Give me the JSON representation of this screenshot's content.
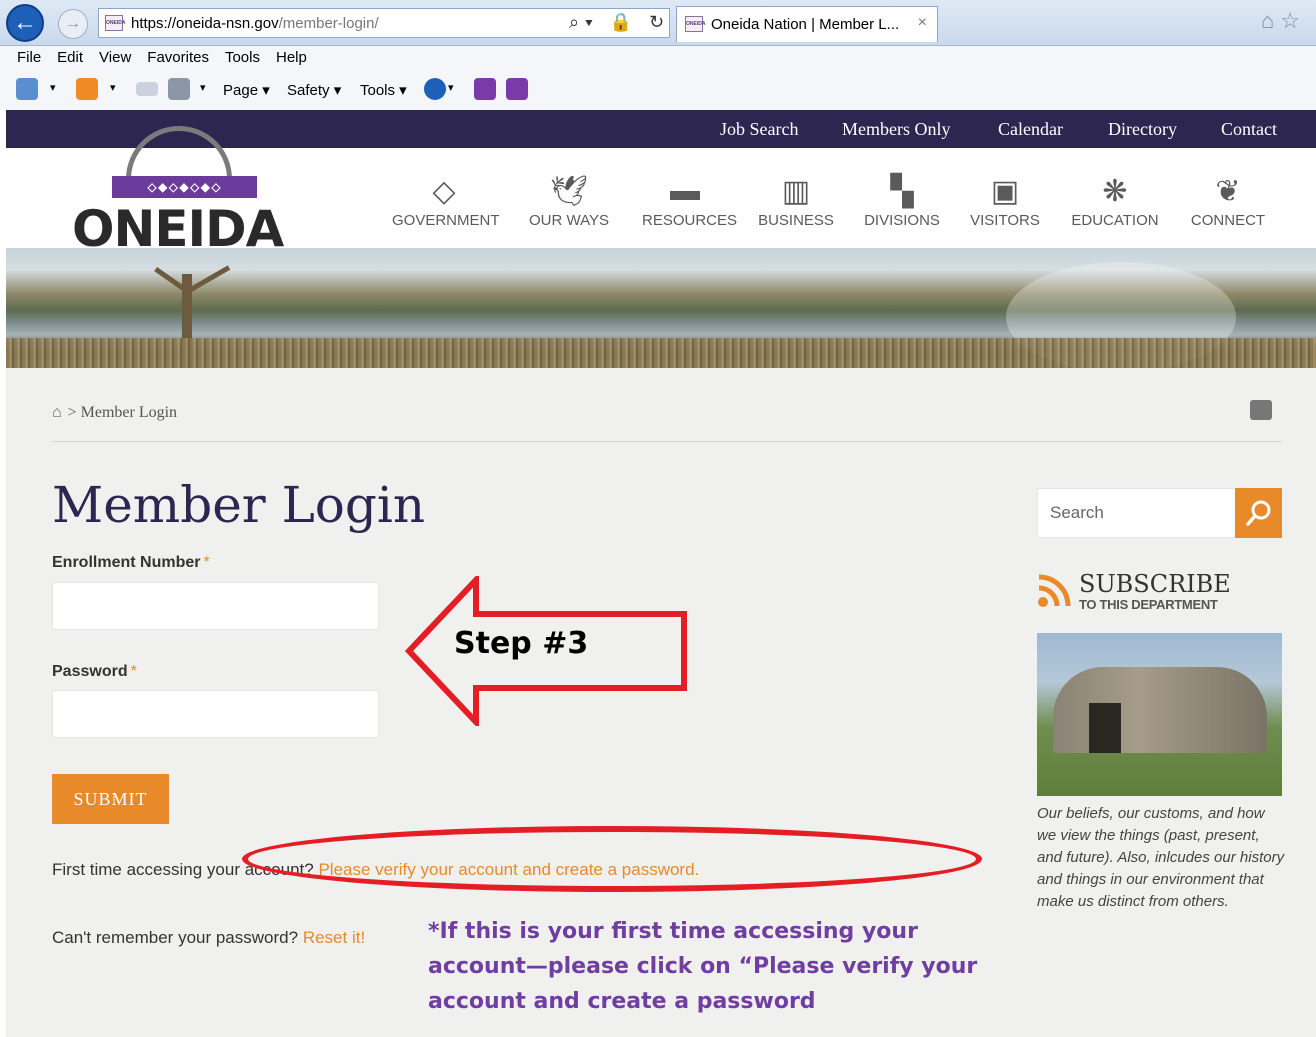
{
  "browser": {
    "url_host": "https://oneida-nsn.gov",
    "url_path": "/member-login/",
    "tab_title": "Oneida Nation | Member L...",
    "tab_close": "×",
    "menu": [
      "File",
      "Edit",
      "View",
      "Favorites",
      "Tools",
      "Help"
    ],
    "commands": {
      "page": "Page ▾",
      "safety": "Safety ▾",
      "tools": "Tools ▾"
    }
  },
  "site": {
    "top_links": [
      "Job Search",
      "Members Only",
      "Calendar",
      "Directory",
      "Contact"
    ],
    "logo_text": "ONEIDA",
    "nav": [
      "GOVERNMENT",
      "OUR WAYS",
      "RESOURCES",
      "BUSINESS",
      "DIVISIONS",
      "VISITORS",
      "EDUCATION",
      "CONNECT"
    ],
    "breadcrumb": "> Member Login"
  },
  "form": {
    "title": "Member Login",
    "enrollment_label": "Enrollment Number",
    "password_label": "Password",
    "required_mark": "*",
    "submit": "SUBMIT",
    "first_time_prefix": "First time accessing your account?",
    "first_time_link": "Please verify your account and create a password.",
    "forgot_prefix": "Can't remember your password?",
    "forgot_link": "Reset it!"
  },
  "sidebar": {
    "search_placeholder": "Search",
    "subscribe_title": "SUBSCRIBE",
    "subscribe_sub": "TO THIS DEPARTMENT",
    "caption": "Our beliefs, our customs, and how we view the things (past, present, and future). Also, inlcudes our history and things in our environment that make us distinct from others."
  },
  "annotations": {
    "step": "Step #3",
    "note": "*If this is your first time accessing your account—please click on “Please verify your account and create a password"
  },
  "colors": {
    "accent": "#e8892a",
    "nav_bg": "#2c2650",
    "annotation_red": "#e31e24",
    "note_purple": "#6f3ea0"
  }
}
